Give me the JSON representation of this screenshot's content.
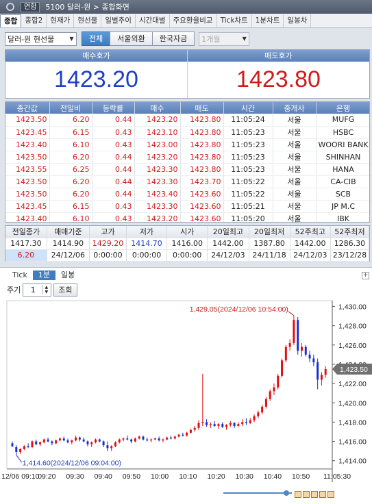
{
  "titlebar": {
    "tag": "연합",
    "title": "5100 달러-원 > 종합화면"
  },
  "tabs": [
    "종합",
    "종합2",
    "현재가",
    "현선물",
    "일별추이",
    "시간대별",
    "주요환율비교",
    "Tick차트",
    "1분차트",
    "일봉차"
  ],
  "active_tab": 0,
  "filters": {
    "instrument": "달러-원 현선물",
    "segments": [
      "전체",
      "서울외환",
      "한국자금"
    ],
    "active_segment": 0,
    "period": "1개월"
  },
  "quote": {
    "bid_label": "매수호가",
    "ask_label": "매도호가",
    "bid": "1423.20",
    "ask": "1423.80"
  },
  "trades": {
    "columns": [
      "종간값",
      "전일비",
      "등락률",
      "매수",
      "매도",
      "시간",
      "중개사",
      "은행"
    ],
    "rows": [
      [
        "1423.50",
        "6.20",
        "0.44",
        "1423.20",
        "1423.80",
        "11:05:24",
        "서울",
        "MUFG"
      ],
      [
        "1423.45",
        "6.15",
        "0.43",
        "1423.10",
        "1423.80",
        "11:05:23",
        "서울",
        "HSBC"
      ],
      [
        "1423.40",
        "6.10",
        "0.43",
        "1423.00",
        "1423.80",
        "11:05:23",
        "서울",
        "WOORI BANK"
      ],
      [
        "1423.50",
        "6.20",
        "0.44",
        "1423.20",
        "1423.80",
        "11:05:23",
        "서울",
        "SHINHAN"
      ],
      [
        "1423.55",
        "6.25",
        "0.44",
        "1423.30",
        "1423.80",
        "11:05:23",
        "서울",
        "HANA"
      ],
      [
        "1423.50",
        "6.20",
        "0.44",
        "1423.30",
        "1423.70",
        "11:05:22",
        "서울",
        "CA-CIB"
      ],
      [
        "1423.50",
        "6.20",
        "0.44",
        "1423.40",
        "1423.60",
        "11:05:22",
        "서울",
        "SCB"
      ],
      [
        "1423.45",
        "6.15",
        "0.43",
        "1423.30",
        "1423.60",
        "11:05:21",
        "서울",
        "JP M.C"
      ],
      [
        "1423.40",
        "6.10",
        "0.43",
        "1423.20",
        "1423.60",
        "11:05:20",
        "서울",
        "IBK"
      ]
    ]
  },
  "summary": {
    "labels_row1": [
      "전일종가",
      "매매기준",
      "고가",
      "저가",
      "시가",
      "20일최고",
      "20일최저",
      "52주최고",
      "52주최저"
    ],
    "values_row1": [
      "1417.30",
      "1414.90",
      "1429.20",
      "1414.70",
      "1416.00",
      "1442.00",
      "1387.80",
      "1442.00",
      "1286.30"
    ],
    "values_row2": [
      "6.20",
      "24/12/06",
      "0:00:00",
      "0:00:00",
      "0:00:00",
      "24/12/03",
      "24/11/18",
      "24/12/03",
      "23/12/28"
    ]
  },
  "chart_tabs": [
    "Tick",
    "1분",
    "일봉"
  ],
  "active_chart_tab": 1,
  "period_control": {
    "label": "주기",
    "value": "1",
    "button": "조회"
  },
  "chart_data": {
    "type": "candlestick",
    "interval": "1분",
    "x_tick_labels": [
      "12/06 09:10",
      "09:20",
      "09:30",
      "09:40",
      "09:50",
      "10:00",
      "10:10",
      "10:20",
      "10:30",
      "10:40",
      "10:50",
      "11:05:30"
    ],
    "y_tick_labels": [
      "1,430.00",
      "1,428.00",
      "1,426.00",
      "1,424.00",
      "1,422.00",
      "1,420.00",
      "1,418.00",
      "1,416.00",
      "1,414.00"
    ],
    "ylim": [
      1413.2,
      1430.6
    ],
    "current_price": "1,423.50",
    "high_annotation": "1,429.05(2024/12/06 10:54:00)",
    "low_annotation": "1,414.60(2024/12/06 09:04:00)",
    "colors": {
      "up": "#e01010",
      "down": "#1a2fd0"
    },
    "candles": [
      {
        "o": 1415.8,
        "h": 1416.0,
        "l": 1415.4,
        "c": 1415.5
      },
      {
        "o": 1415.4,
        "h": 1415.6,
        "l": 1414.6,
        "c": 1414.9
      },
      {
        "o": 1414.9,
        "h": 1415.3,
        "l": 1414.7,
        "c": 1415.2
      },
      {
        "o": 1415.2,
        "h": 1415.6,
        "l": 1415.1,
        "c": 1415.5
      },
      {
        "o": 1415.5,
        "h": 1415.8,
        "l": 1415.3,
        "c": 1415.4
      },
      {
        "o": 1415.4,
        "h": 1416.1,
        "l": 1415.3,
        "c": 1416.0
      },
      {
        "o": 1416.0,
        "h": 1416.2,
        "l": 1415.6,
        "c": 1415.7
      },
      {
        "o": 1415.7,
        "h": 1416.0,
        "l": 1415.5,
        "c": 1415.9
      },
      {
        "o": 1415.9,
        "h": 1416.3,
        "l": 1415.8,
        "c": 1416.2
      },
      {
        "o": 1416.2,
        "h": 1416.4,
        "l": 1415.9,
        "c": 1416.0
      },
      {
        "o": 1416.0,
        "h": 1416.1,
        "l": 1415.6,
        "c": 1415.8
      },
      {
        "o": 1415.8,
        "h": 1416.2,
        "l": 1415.7,
        "c": 1416.1
      },
      {
        "o": 1416.1,
        "h": 1416.4,
        "l": 1416.0,
        "c": 1416.3
      },
      {
        "o": 1416.3,
        "h": 1416.5,
        "l": 1416.0,
        "c": 1416.1
      },
      {
        "o": 1416.1,
        "h": 1416.3,
        "l": 1415.8,
        "c": 1415.9
      },
      {
        "o": 1415.9,
        "h": 1416.2,
        "l": 1415.7,
        "c": 1416.1
      },
      {
        "o": 1416.1,
        "h": 1416.6,
        "l": 1416.0,
        "c": 1416.4
      },
      {
        "o": 1416.4,
        "h": 1416.5,
        "l": 1416.0,
        "c": 1416.2
      },
      {
        "o": 1416.2,
        "h": 1416.4,
        "l": 1415.9,
        "c": 1416.0
      },
      {
        "o": 1416.0,
        "h": 1416.1,
        "l": 1415.5,
        "c": 1415.7
      },
      {
        "o": 1415.7,
        "h": 1416.0,
        "l": 1415.4,
        "c": 1415.9
      },
      {
        "o": 1415.9,
        "h": 1416.3,
        "l": 1415.8,
        "c": 1416.2
      },
      {
        "o": 1416.2,
        "h": 1416.3,
        "l": 1415.9,
        "c": 1416.0
      },
      {
        "o": 1416.0,
        "h": 1416.1,
        "l": 1415.4,
        "c": 1415.6
      },
      {
        "o": 1415.6,
        "h": 1416.0,
        "l": 1415.0,
        "c": 1415.3
      },
      {
        "o": 1415.3,
        "h": 1415.6,
        "l": 1415.0,
        "c": 1415.5
      },
      {
        "o": 1415.5,
        "h": 1416.0,
        "l": 1415.4,
        "c": 1415.9
      },
      {
        "o": 1415.9,
        "h": 1416.3,
        "l": 1415.8,
        "c": 1416.2
      },
      {
        "o": 1416.2,
        "h": 1416.4,
        "l": 1416.0,
        "c": 1416.3
      },
      {
        "o": 1416.3,
        "h": 1416.6,
        "l": 1416.1,
        "c": 1416.2
      },
      {
        "o": 1416.2,
        "h": 1416.3,
        "l": 1415.8,
        "c": 1416.0
      },
      {
        "o": 1416.0,
        "h": 1416.4,
        "l": 1415.9,
        "c": 1416.3
      },
      {
        "o": 1416.3,
        "h": 1416.6,
        "l": 1416.2,
        "c": 1416.5
      },
      {
        "o": 1416.5,
        "h": 1416.6,
        "l": 1416.1,
        "c": 1416.2
      },
      {
        "o": 1416.2,
        "h": 1416.4,
        "l": 1416.0,
        "c": 1416.1
      },
      {
        "o": 1416.1,
        "h": 1416.3,
        "l": 1415.9,
        "c": 1416.2
      },
      {
        "o": 1416.2,
        "h": 1416.4,
        "l": 1416.1,
        "c": 1416.3
      },
      {
        "o": 1416.3,
        "h": 1416.5,
        "l": 1416.0,
        "c": 1416.1
      },
      {
        "o": 1416.1,
        "h": 1416.3,
        "l": 1415.9,
        "c": 1416.2
      },
      {
        "o": 1416.2,
        "h": 1416.5,
        "l": 1416.1,
        "c": 1416.4
      },
      {
        "o": 1416.4,
        "h": 1416.6,
        "l": 1416.2,
        "c": 1416.3
      },
      {
        "o": 1416.3,
        "h": 1416.6,
        "l": 1416.2,
        "c": 1416.5
      },
      {
        "o": 1416.5,
        "h": 1416.8,
        "l": 1416.4,
        "c": 1416.7
      },
      {
        "o": 1416.7,
        "h": 1416.9,
        "l": 1416.5,
        "c": 1416.6
      },
      {
        "o": 1416.6,
        "h": 1417.0,
        "l": 1416.5,
        "c": 1416.9
      },
      {
        "o": 1416.9,
        "h": 1417.3,
        "l": 1416.8,
        "c": 1417.2
      },
      {
        "o": 1417.2,
        "h": 1417.6,
        "l": 1417.0,
        "c": 1417.4
      },
      {
        "o": 1417.4,
        "h": 1418.2,
        "l": 1417.2,
        "c": 1417.9
      },
      {
        "o": 1417.9,
        "h": 1423.0,
        "l": 1417.6,
        "c": 1418.0
      },
      {
        "o": 1418.0,
        "h": 1418.3,
        "l": 1417.5,
        "c": 1417.7
      },
      {
        "o": 1417.7,
        "h": 1418.0,
        "l": 1417.4,
        "c": 1417.8
      },
      {
        "o": 1417.8,
        "h": 1418.1,
        "l": 1417.5,
        "c": 1417.6
      },
      {
        "o": 1417.6,
        "h": 1417.9,
        "l": 1417.3,
        "c": 1417.8
      },
      {
        "o": 1417.8,
        "h": 1418.0,
        "l": 1417.4,
        "c": 1417.5
      },
      {
        "o": 1417.5,
        "h": 1417.8,
        "l": 1417.2,
        "c": 1417.7
      },
      {
        "o": 1417.7,
        "h": 1418.1,
        "l": 1417.5,
        "c": 1417.9
      },
      {
        "o": 1417.9,
        "h": 1418.0,
        "l": 1417.4,
        "c": 1417.6
      },
      {
        "o": 1417.6,
        "h": 1418.0,
        "l": 1417.5,
        "c": 1417.8
      },
      {
        "o": 1417.8,
        "h": 1418.3,
        "l": 1417.6,
        "c": 1418.0
      },
      {
        "o": 1418.0,
        "h": 1418.4,
        "l": 1417.7,
        "c": 1417.9
      },
      {
        "o": 1417.9,
        "h": 1418.4,
        "l": 1417.8,
        "c": 1418.2
      },
      {
        "o": 1418.2,
        "h": 1418.8,
        "l": 1418.0,
        "c": 1418.6
      },
      {
        "o": 1418.6,
        "h": 1419.2,
        "l": 1418.4,
        "c": 1419.0
      },
      {
        "o": 1419.0,
        "h": 1419.8,
        "l": 1418.8,
        "c": 1419.6
      },
      {
        "o": 1419.6,
        "h": 1420.6,
        "l": 1419.4,
        "c": 1420.4
      },
      {
        "o": 1420.4,
        "h": 1421.4,
        "l": 1420.2,
        "c": 1421.2
      },
      {
        "o": 1421.2,
        "h": 1422.0,
        "l": 1420.8,
        "c": 1421.6
      },
      {
        "o": 1421.6,
        "h": 1423.0,
        "l": 1421.4,
        "c": 1422.8
      },
      {
        "o": 1422.8,
        "h": 1424.6,
        "l": 1422.6,
        "c": 1424.4
      },
      {
        "o": 1424.4,
        "h": 1426.0,
        "l": 1424.2,
        "c": 1425.8
      },
      {
        "o": 1425.8,
        "h": 1426.6,
        "l": 1425.4,
        "c": 1426.2
      },
      {
        "o": 1426.2,
        "h": 1429.05,
        "l": 1426.0,
        "c": 1428.6
      },
      {
        "o": 1428.6,
        "h": 1428.9,
        "l": 1425.0,
        "c": 1425.4
      },
      {
        "o": 1425.4,
        "h": 1426.2,
        "l": 1424.8,
        "c": 1425.8
      },
      {
        "o": 1425.8,
        "h": 1426.0,
        "l": 1424.8,
        "c": 1425.0
      },
      {
        "o": 1425.0,
        "h": 1425.4,
        "l": 1424.2,
        "c": 1424.6
      },
      {
        "o": 1424.6,
        "h": 1425.0,
        "l": 1423.8,
        "c": 1424.2
      },
      {
        "o": 1424.2,
        "h": 1424.6,
        "l": 1421.4,
        "c": 1422.4
      },
      {
        "o": 1422.4,
        "h": 1423.2,
        "l": 1421.8,
        "c": 1422.9
      },
      {
        "o": 1422.9,
        "h": 1423.8,
        "l": 1422.6,
        "c": 1423.5
      }
    ]
  }
}
